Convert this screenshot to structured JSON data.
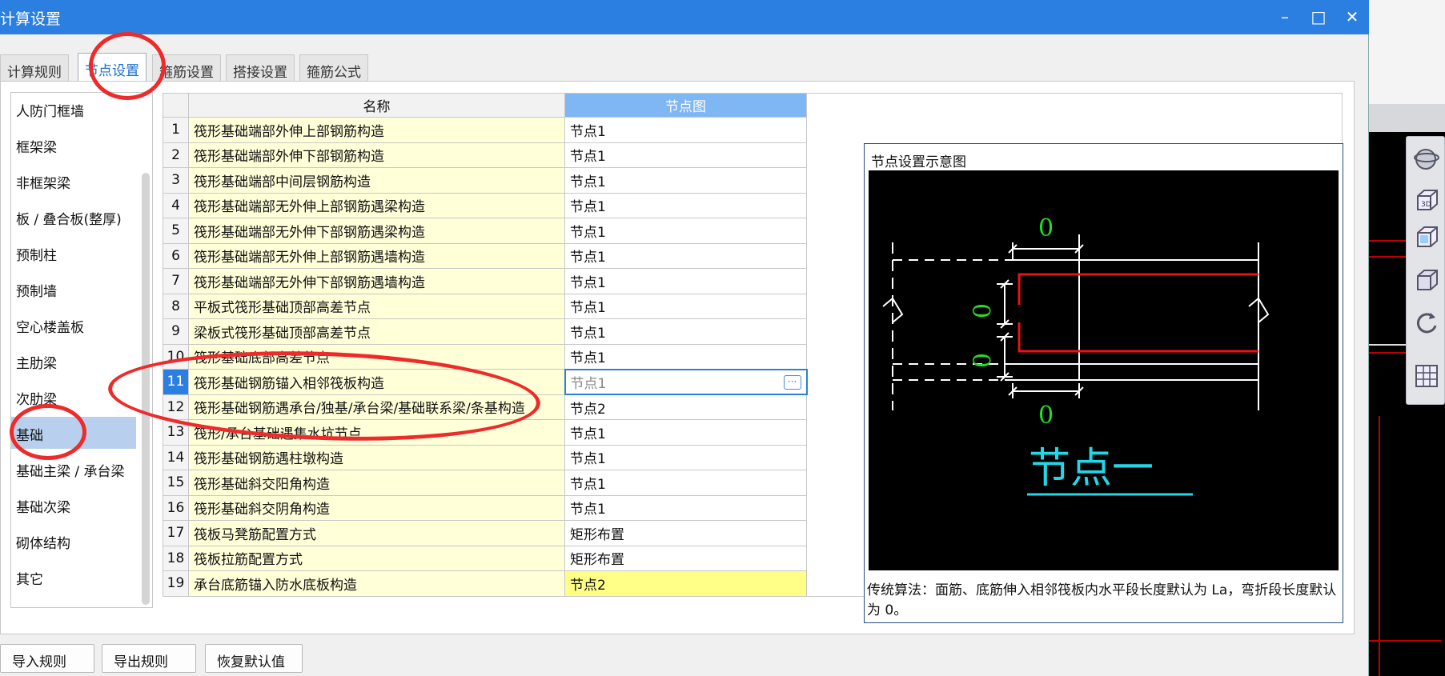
{
  "window": {
    "title": "计算设置",
    "minimize": "–",
    "maximize": "□",
    "close": "✕"
  },
  "tabs": [
    {
      "label": "计算规则"
    },
    {
      "label": "节点设置"
    },
    {
      "label": "箍筋设置"
    },
    {
      "label": "搭接设置"
    },
    {
      "label": "箍筋公式"
    }
  ],
  "left_list": [
    {
      "label": "人防门框墙"
    },
    {
      "label": "框架梁"
    },
    {
      "label": "非框架梁"
    },
    {
      "label": "板 / 叠合板(整厚)"
    },
    {
      "label": "预制柱"
    },
    {
      "label": "预制墙"
    },
    {
      "label": "空心楼盖板"
    },
    {
      "label": "主肋梁"
    },
    {
      "label": "次肋梁"
    },
    {
      "label": "基础"
    },
    {
      "label": "基础主梁 / 承台梁"
    },
    {
      "label": "基础次梁"
    },
    {
      "label": "砌体结构"
    },
    {
      "label": "其它"
    }
  ],
  "table": {
    "columns": [
      "名称",
      "节点图"
    ],
    "rows": [
      {
        "num": "1",
        "name": "筏形基础端部外伸上部钢筋构造",
        "value": "节点1"
      },
      {
        "num": "2",
        "name": "筏形基础端部外伸下部钢筋构造",
        "value": "节点1"
      },
      {
        "num": "3",
        "name": "筏形基础端部中间层钢筋构造",
        "value": "节点1"
      },
      {
        "num": "4",
        "name": "筏形基础端部无外伸上部钢筋遇梁构造",
        "value": "节点1"
      },
      {
        "num": "5",
        "name": "筏形基础端部无外伸下部钢筋遇梁构造",
        "value": "节点1"
      },
      {
        "num": "6",
        "name": "筏形基础端部无外伸上部钢筋遇墙构造",
        "value": "节点1"
      },
      {
        "num": "7",
        "name": "筏形基础端部无外伸下部钢筋遇墙构造",
        "value": "节点1"
      },
      {
        "num": "8",
        "name": "平板式筏形基础顶部高差节点",
        "value": "节点1"
      },
      {
        "num": "9",
        "name": "梁板式筏形基础顶部高差节点",
        "value": "节点1"
      },
      {
        "num": "10",
        "name": "筏形基础底部高差节点",
        "value": "节点1"
      },
      {
        "num": "11",
        "name": "筏形基础钢筋锚入相邻筏板构造",
        "value": "节点1"
      },
      {
        "num": "12",
        "name": "筏形基础钢筋遇承台/独基/承台梁/基础联系梁/条基构造",
        "value": "节点2"
      },
      {
        "num": "13",
        "name": "筏形/承台基础遇集水坑节点",
        "value": "节点1"
      },
      {
        "num": "14",
        "name": "筏形基础钢筋遇柱墩构造",
        "value": "节点1"
      },
      {
        "num": "15",
        "name": "筏形基础斜交阳角构造",
        "value": "节点1"
      },
      {
        "num": "16",
        "name": "筏形基础斜交阴角构造",
        "value": "节点1"
      },
      {
        "num": "17",
        "name": "筏板马凳筋配置方式",
        "value": "矩形布置"
      },
      {
        "num": "18",
        "name": "筏板拉筋配置方式",
        "value": "矩形布置"
      },
      {
        "num": "19",
        "name": "承台底筋锚入防水底板构造",
        "value": "节点2"
      }
    ]
  },
  "preview": {
    "title": "节点设置示意图",
    "caption": "节点一",
    "dim_top": "0",
    "dim_mid1": "0",
    "dim_mid2": "0",
    "dim_bottom": "0",
    "description": "传统算法：面筋、底筋伸入相邻筏板内水平段长度默认为 La，弯折段长度默认为 0。"
  },
  "buttons": {
    "import": "导入规则",
    "export": "导出规则",
    "restore": "恢复默认值"
  },
  "toolbox_icons": [
    "orbit-icon",
    "3d-view-icon",
    "cube-view-icon",
    "box-view-icon",
    "rotate-icon",
    "grid-icon"
  ],
  "colors": {
    "titlebar": "#2b7fe0",
    "annotation": "#ee2a2a",
    "canvas_green": "#22dd22",
    "canvas_red": "#ee1111",
    "canvas_cyan": "#22d8e8"
  }
}
